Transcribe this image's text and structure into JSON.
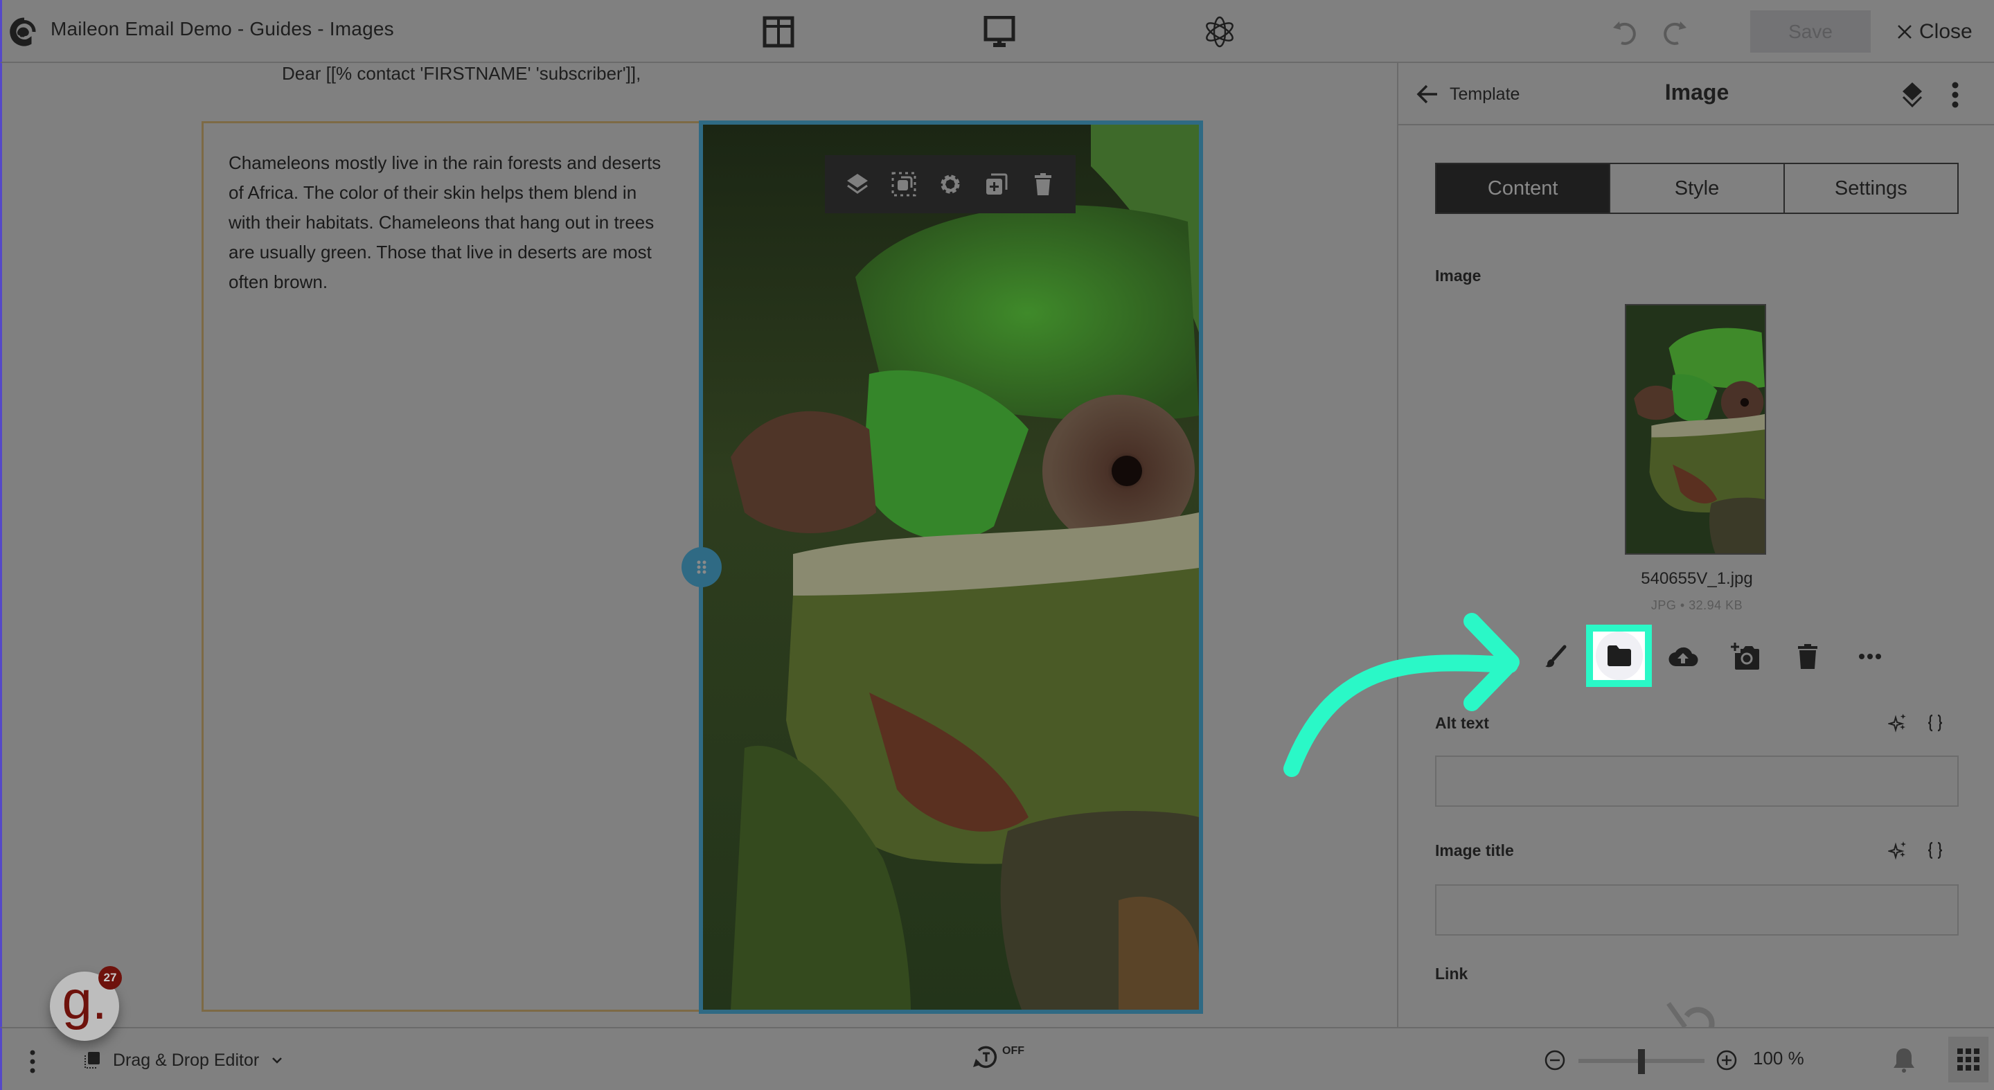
{
  "app": {
    "title": "Maileon Email Demo - Guides - Images"
  },
  "topbar": {
    "icons": [
      "layout-icon",
      "desktop-preview-icon",
      "atom-icon"
    ],
    "undo_icon": "undo-icon",
    "redo_icon": "redo-icon",
    "save_label": "Save",
    "close_label": "Close"
  },
  "canvas": {
    "greeting": "Dear [[% contact 'FIRSTNAME' 'subscriber']],",
    "body_text": "Chameleons mostly live in the rain forests and deserts of Africa. The color of their skin helps them blend in with their habitats. Chameleons that hang out in trees are usually green. Those that live in deserts are most often brown.",
    "block_toolbar": [
      "layers-icon",
      "select-parent-icon",
      "settings-icon",
      "duplicate-icon",
      "delete-icon"
    ]
  },
  "panel": {
    "back_label": "Template",
    "title": "Image",
    "tabs": [
      {
        "label": "Content",
        "active": true
      },
      {
        "label": "Style",
        "active": false
      },
      {
        "label": "Settings",
        "active": false
      }
    ],
    "image_section_label": "Image",
    "file_name": "540655V_1.jpg",
    "file_meta": "JPG • 32.94 KB",
    "image_actions": [
      "edit-brush-icon",
      "browse-folder-icon",
      "upload-cloud-icon",
      "add-photo-icon",
      "delete-icon",
      "more-horizontal-icon"
    ],
    "alt_text": {
      "label": "Alt text",
      "value": "",
      "placeholder": ""
    },
    "image_title": {
      "label": "Image title",
      "value": "",
      "placeholder": ""
    },
    "link_label": "Link"
  },
  "bottombar": {
    "editor_mode": "Drag & Drop Editor",
    "autosave_label": "OFF",
    "zoom_percent": 100,
    "zoom_label": "100 %",
    "guide_count": "27"
  },
  "colors": {
    "highlight": "#2af8c7",
    "selection_border": "#2f6a84",
    "text_block_border": "#7d6a45",
    "guide_brand": "#6e120c"
  }
}
